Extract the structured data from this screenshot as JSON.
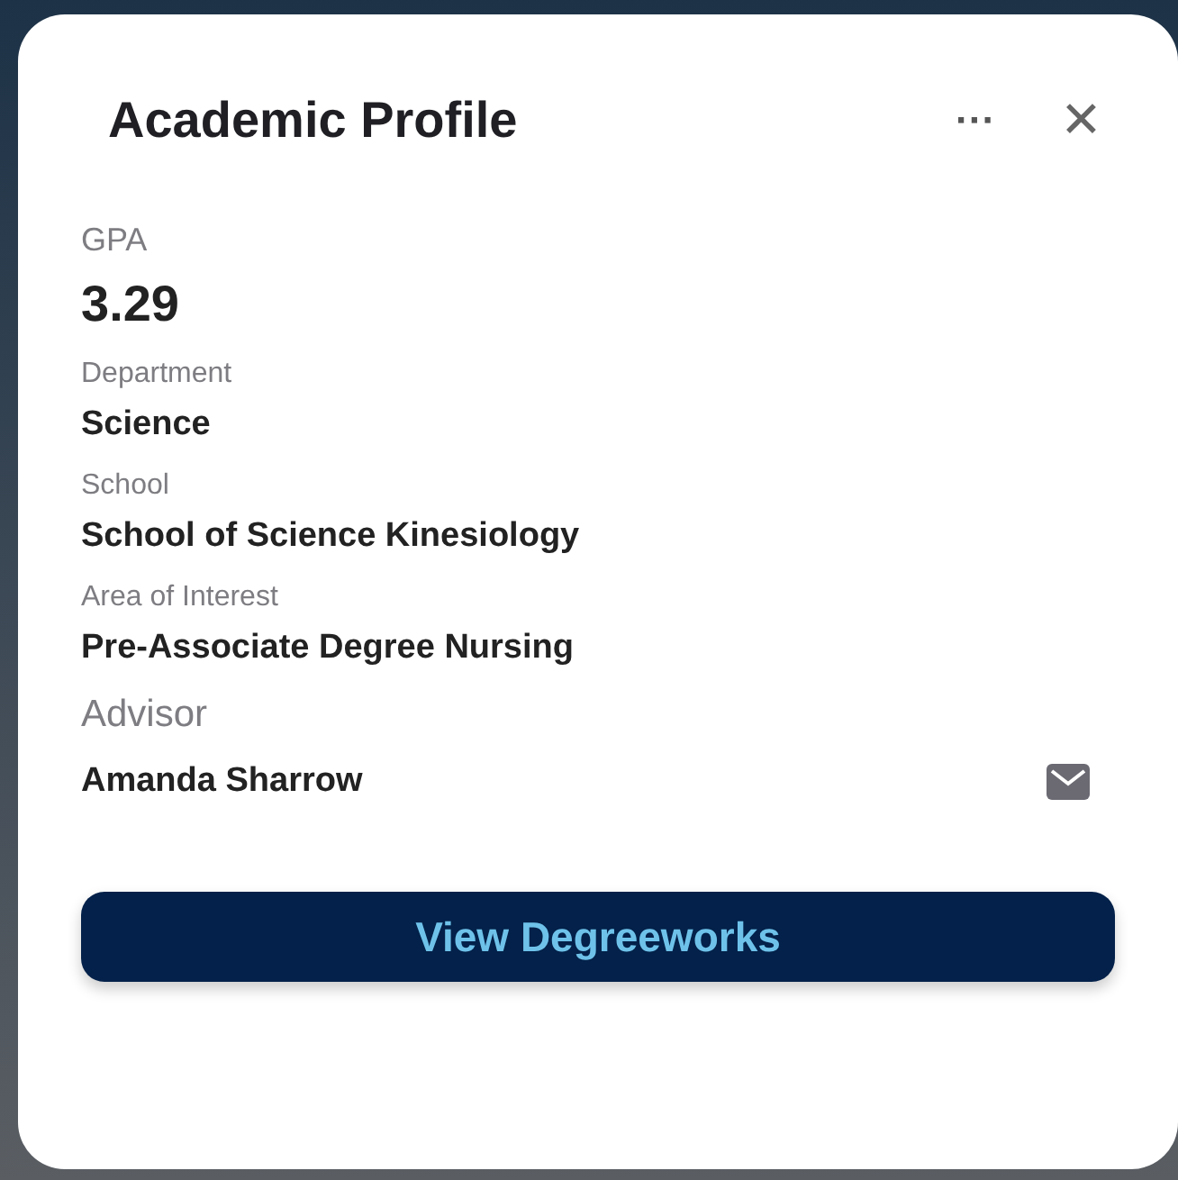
{
  "header": {
    "title": "Academic Profile",
    "more": "···",
    "close": "✕"
  },
  "fields": [
    {
      "kind": "stat",
      "label": "GPA",
      "value": "3.29"
    },
    {
      "kind": "field",
      "label": "Department",
      "value": "Science"
    },
    {
      "kind": "field",
      "label": "School",
      "value": "School of Science Kinesiology"
    },
    {
      "kind": "field",
      "label": "Area of Interest",
      "value": "Pre-Associate Degree Nursing"
    },
    {
      "kind": "contact",
      "label": "Advisor",
      "value": "Amanda Sharrow"
    }
  ],
  "button": {
    "label": "View Degreeworks"
  }
}
